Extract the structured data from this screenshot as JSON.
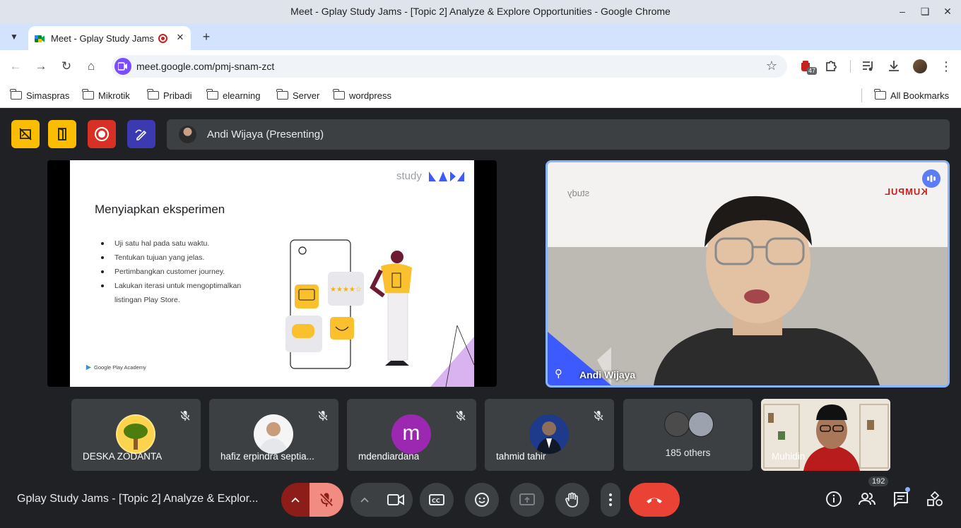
{
  "window": {
    "title": "Meet - Gplay Study Jams - [Topic 2] Analyze & Explore Opportunities - Google Chrome"
  },
  "tab": {
    "title": "Meet - Gplay Study Jams"
  },
  "omnibox": {
    "url": "meet.google.com/pmj-snam-zct"
  },
  "extensions": {
    "badge": "47"
  },
  "bookmarks": {
    "items": [
      "Simaspras",
      "Mikrotik",
      "Pribadi",
      "elearning",
      "Server",
      "wordpress"
    ],
    "all": "All Bookmarks"
  },
  "presenter": {
    "label": "Andi Wijaya (Presenting)"
  },
  "slide": {
    "brand": "study",
    "title": "Menyiapkan eksperimen",
    "bullets": [
      "Uji satu hal pada satu waktu.",
      "Tentukan tujuan yang jelas.",
      "Pertimbangkan customer journey.",
      "Lakukan iterasi untuk mengoptimalkan listingan Play Store."
    ],
    "footer": "Google Play Academy"
  },
  "speaker": {
    "name": "Andi Wijaya",
    "bg_brand": "KUMPUL",
    "bg_study": "study"
  },
  "participants": [
    {
      "name": "DESKA ZODANTA"
    },
    {
      "name": "hafiz erpindra septia..."
    },
    {
      "name": "mdendiardana",
      "initial": "m"
    },
    {
      "name": "tahmid tahir"
    },
    {
      "name": "185 others"
    },
    {
      "name": "Muhidin"
    }
  ],
  "meeting": {
    "name": "Gplay Study Jams - [Topic 2] Analyze & Explor...",
    "people_count": "192"
  },
  "colors": {
    "accent_blue": "#8ab4f8",
    "end_call": "#ea4335",
    "mic_off": "#c0453b",
    "yellow_button": "#fbbc04",
    "record_red": "#d93025",
    "draw_indigo": "#3c3ab0"
  }
}
